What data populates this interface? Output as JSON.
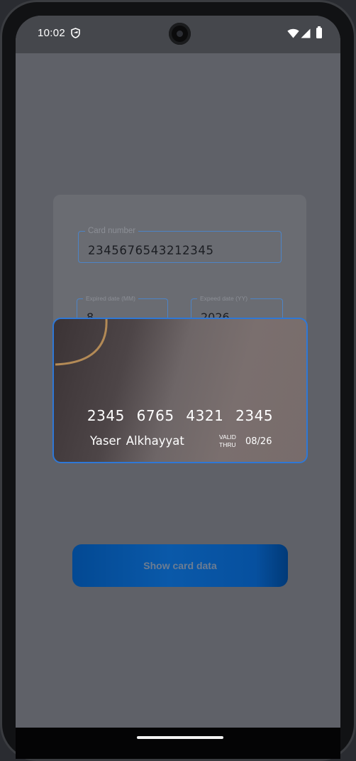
{
  "status_bar": {
    "time": "10:02"
  },
  "form": {
    "card_number": {
      "label": "Card number",
      "value": "2345676543212345"
    },
    "expired_month": {
      "label": "Expired date (MM)",
      "value": "8"
    },
    "expired_year": {
      "label": "Expeed date (YY)",
      "value": "2026"
    }
  },
  "card": {
    "number_display": "2345 6765 4321 2345",
    "holder_name": "Yaser Alkhayyat",
    "valid_thru_label": "VALID THRU",
    "expiry": "08/26"
  },
  "actions": {
    "show_card_data_label": "Show card data"
  },
  "colors": {
    "accent_blue": "#2f78d6",
    "button_blue": "#0a59a9",
    "overlay_gray": "#5f6168",
    "card_arc_gold": "#b38a56"
  }
}
